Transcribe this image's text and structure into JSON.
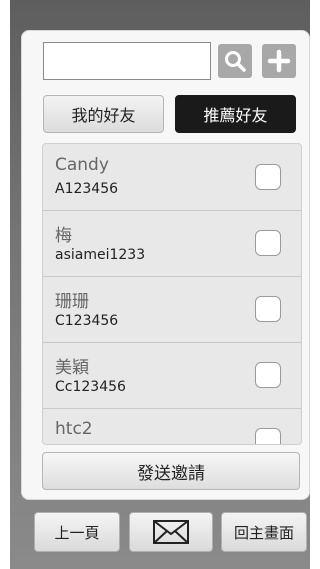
{
  "search": {
    "value": "",
    "placeholder": ""
  },
  "icons": {
    "search": "search-icon",
    "add": "plus-icon",
    "mail": "envelope-icon"
  },
  "tabs": {
    "my_friends": "我的好友",
    "recommended": "推薦好友",
    "active": "recommended"
  },
  "friends": [
    {
      "name": "Candy",
      "id": "A123456",
      "checked": false
    },
    {
      "name": "梅",
      "id": "asiamei1233",
      "checked": false
    },
    {
      "name": "珊珊",
      "id": "C123456",
      "checked": false
    },
    {
      "name": "美穎",
      "id": "Cc123456",
      "checked": false
    },
    {
      "name": "htc2",
      "id": "",
      "checked": false
    }
  ],
  "actions": {
    "send_invite": "發送邀請"
  },
  "bottom_nav": {
    "prev": "上一頁",
    "home": "回主畫面"
  },
  "colors": {
    "frame": "#6e6e6e",
    "active_tab": "#1a1a1a",
    "icon_button": "#a8a8a8"
  }
}
